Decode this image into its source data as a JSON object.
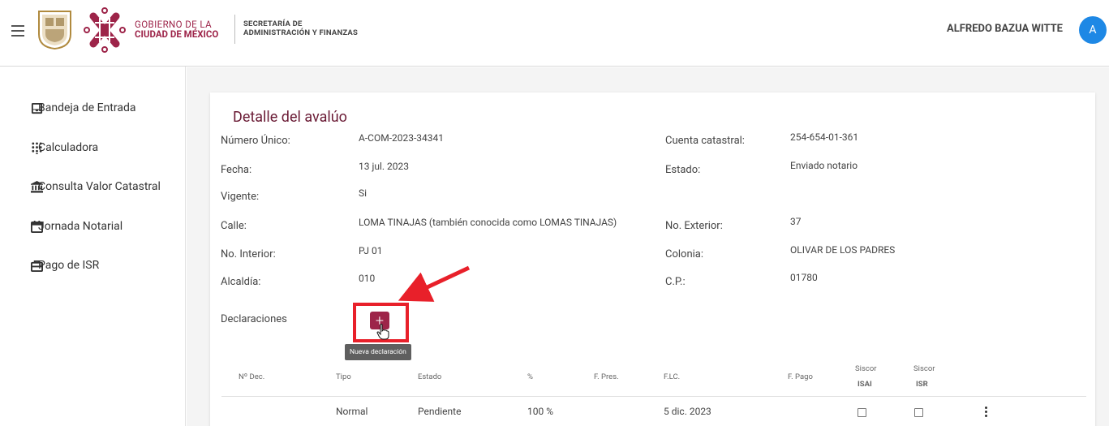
{
  "header": {
    "gov_line1": "GOBIERNO DE LA",
    "gov_line2": "CIUDAD DE MÉXICO",
    "secretaria_line1": "SECRETARÍA DE",
    "secretaria_line2": "ADMINISTRACIÓN Y FINANZAS",
    "user_name": "ALFREDO BAZUA WITTE",
    "avatar_initial": "A"
  },
  "sidebar": {
    "items": [
      {
        "label": "Bandeja de Entrada",
        "icon": "inbox-icon"
      },
      {
        "label": "Calculadora",
        "icon": "calculator-dots-icon"
      },
      {
        "label": "Consulta Valor Catastral",
        "icon": "bank-icon"
      },
      {
        "label": "Jornada Notarial",
        "icon": "calendar-icon"
      },
      {
        "label": "Pago de ISR",
        "icon": "briefcase-icon"
      }
    ]
  },
  "detail": {
    "title": "Detalle del avalúo",
    "fields": {
      "numero_unico": {
        "label": "Número Único:",
        "value": "A-COM-2023-34341"
      },
      "cuenta_catastral": {
        "label": "Cuenta catastral:",
        "value": "254-654-01-361"
      },
      "fecha": {
        "label": "Fecha:",
        "value": "13 jul. 2023"
      },
      "estado": {
        "label": "Estado:",
        "value": "Enviado notario"
      },
      "vigente": {
        "label": "Vigente:",
        "value": "Si"
      },
      "calle": {
        "label": "Calle:",
        "value": "LOMA TINAJAS (también conocida como LOMAS TINAJAS)"
      },
      "no_exterior": {
        "label": "No. Exterior:",
        "value": "37"
      },
      "no_interior": {
        "label": "No. Interior:",
        "value": "PJ 01"
      },
      "colonia": {
        "label": "Colonia:",
        "value": "OLIVAR DE LOS PADRES"
      },
      "alcaldia": {
        "label": "Alcaldía:",
        "value": "010"
      },
      "cp": {
        "label": "C.P.:",
        "value": "01780"
      }
    }
  },
  "declaraciones": {
    "label": "Declaraciones",
    "add_button_symbol": "+",
    "tooltip": "Nueva declaración",
    "columns": {
      "no_dec": "Nº Dec.",
      "tipo": "Tipo",
      "estado": "Estado",
      "pct": "%",
      "f_pres": "F. Pres.",
      "flc": "F.LC.",
      "f_pago": "F. Pago",
      "siscor_isai_top": "Siscor",
      "siscor_isai_bottom": "ISAI",
      "siscor_isr_top": "Siscor",
      "siscor_isr_bottom": "ISR"
    },
    "rows": [
      {
        "no_dec": "",
        "tipo": "Normal",
        "estado": "Pendiente",
        "pct": "100 %",
        "f_pres": "",
        "flc": "5 dic. 2023",
        "f_pago": ""
      }
    ]
  },
  "colors": {
    "brand": "#9d2449",
    "title": "#6b1c36",
    "avatar": "#1e88e5",
    "annotation": "#e8202a"
  }
}
